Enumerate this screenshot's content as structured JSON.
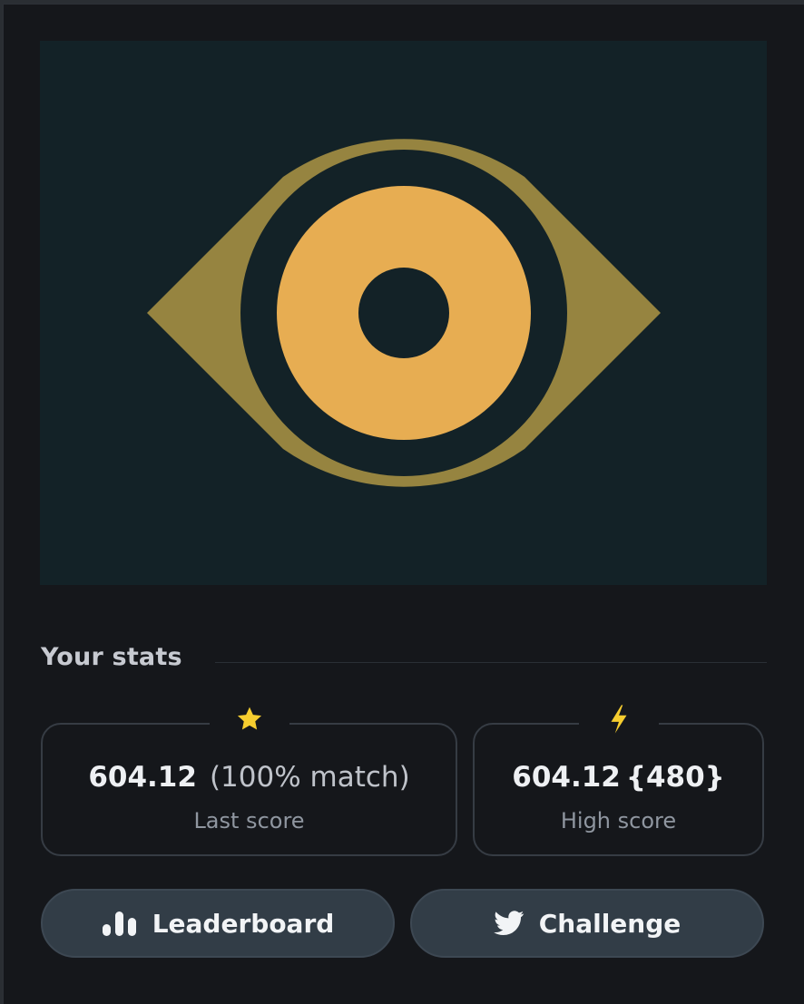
{
  "artwork": {
    "background": "#132227",
    "outer_eye_color": "#968440",
    "iris_color": "#e7ad52",
    "pupil_color": "#132227"
  },
  "stats": {
    "title": "Your stats",
    "last": {
      "icon": "star-icon",
      "score": "604.12",
      "match": "(100% match)",
      "label": "Last score"
    },
    "high": {
      "icon": "lightning-icon",
      "score": "604.12",
      "best": "{480}",
      "label": "High score"
    }
  },
  "actions": {
    "leaderboard": {
      "label": "Leaderboard",
      "icon": "bar-chart-icon"
    },
    "challenge": {
      "label": "Challenge",
      "icon": "twitter-icon"
    }
  },
  "colors": {
    "star": "#f6cd2f",
    "lightning": "#f6cd2f"
  }
}
